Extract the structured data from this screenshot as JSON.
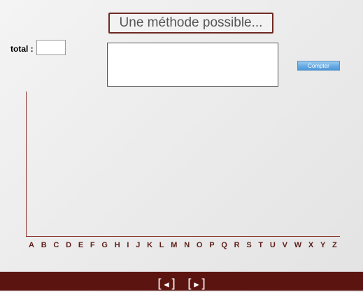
{
  "title": "Une méthode possible...",
  "total": {
    "label": "total :",
    "value": ""
  },
  "textarea": {
    "value": ""
  },
  "count_button": {
    "label": "Compter"
  },
  "colors": {
    "accent": "#6e2a22",
    "footer": "#5c1410",
    "axis": "#8a3a33",
    "letters": "#5e1f19",
    "button": "#6aaee6"
  },
  "alphabet": [
    "A",
    "B",
    "C",
    "D",
    "E",
    "F",
    "G",
    "H",
    "I",
    "J",
    "K",
    "L",
    "M",
    "N",
    "O",
    "P",
    "Q",
    "R",
    "S",
    "T",
    "U",
    "V",
    "W",
    "X",
    "Y",
    "Z"
  ],
  "nav": {
    "prev": {
      "open": "[",
      "icon": "◀",
      "close": "]"
    },
    "next": {
      "open": "[",
      "icon": "▶",
      "close": "]"
    }
  }
}
